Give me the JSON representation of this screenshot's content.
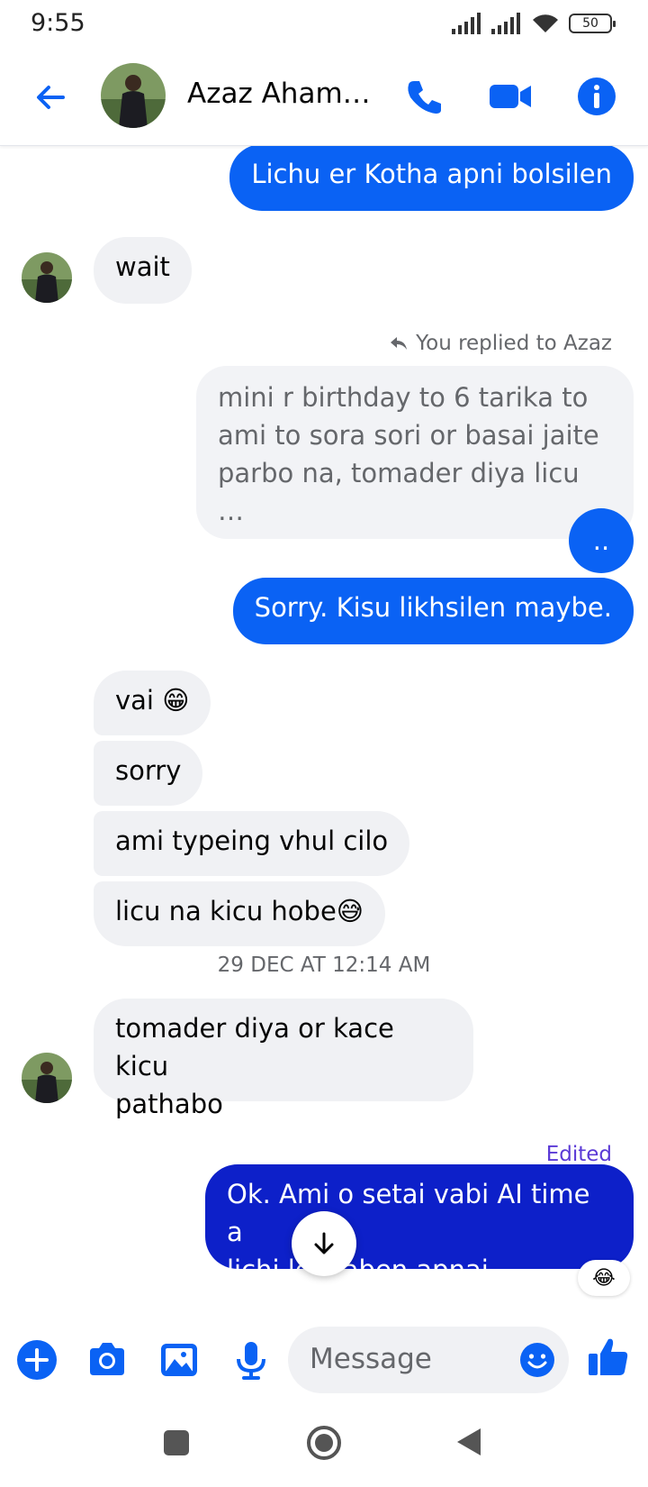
{
  "status_bar": {
    "time": "9:55",
    "battery": "50"
  },
  "header": {
    "contact_name": "Azaz Aham…"
  },
  "messages": {
    "m1": "Lichu er Kotha apni bolsilen",
    "m2": "wait",
    "reply_label": "You replied to Azaz",
    "quoted": "mini r birthday to 6 tarika to ami to sora sori or basai jaite parbo na, tomader diya licu …",
    "m3": "..",
    "m4": "Sorry. Kisu likhsilen maybe.",
    "m5": "vai 😁",
    "m6": "sorry",
    "m7": "ami typeing vhul cilo",
    "m8": "licu na kicu hobe😅",
    "timestamp": "29 DEC AT 12:14 AM",
    "m9_line1": "tomader diya or kace kicu",
    "m9_line2": "pathabo",
    "edited_label": "Edited",
    "m10_line1": "Ok. Ami o setai vabi AI time a",
    "m10_line2": "lichi lekhaben apnai",
    "reaction": "😂"
  },
  "composer": {
    "placeholder": "Message"
  },
  "colors": {
    "accent": "#0a62f4",
    "outgoing_dark": "#0d20c9",
    "incoming": "#f0f1f4"
  },
  "icons": [
    "back-arrow-icon",
    "phone-icon",
    "video-icon",
    "info-icon",
    "plus-icon",
    "camera-icon",
    "gallery-icon",
    "mic-icon",
    "emoji-icon",
    "like-icon",
    "arrow-down-icon"
  ]
}
